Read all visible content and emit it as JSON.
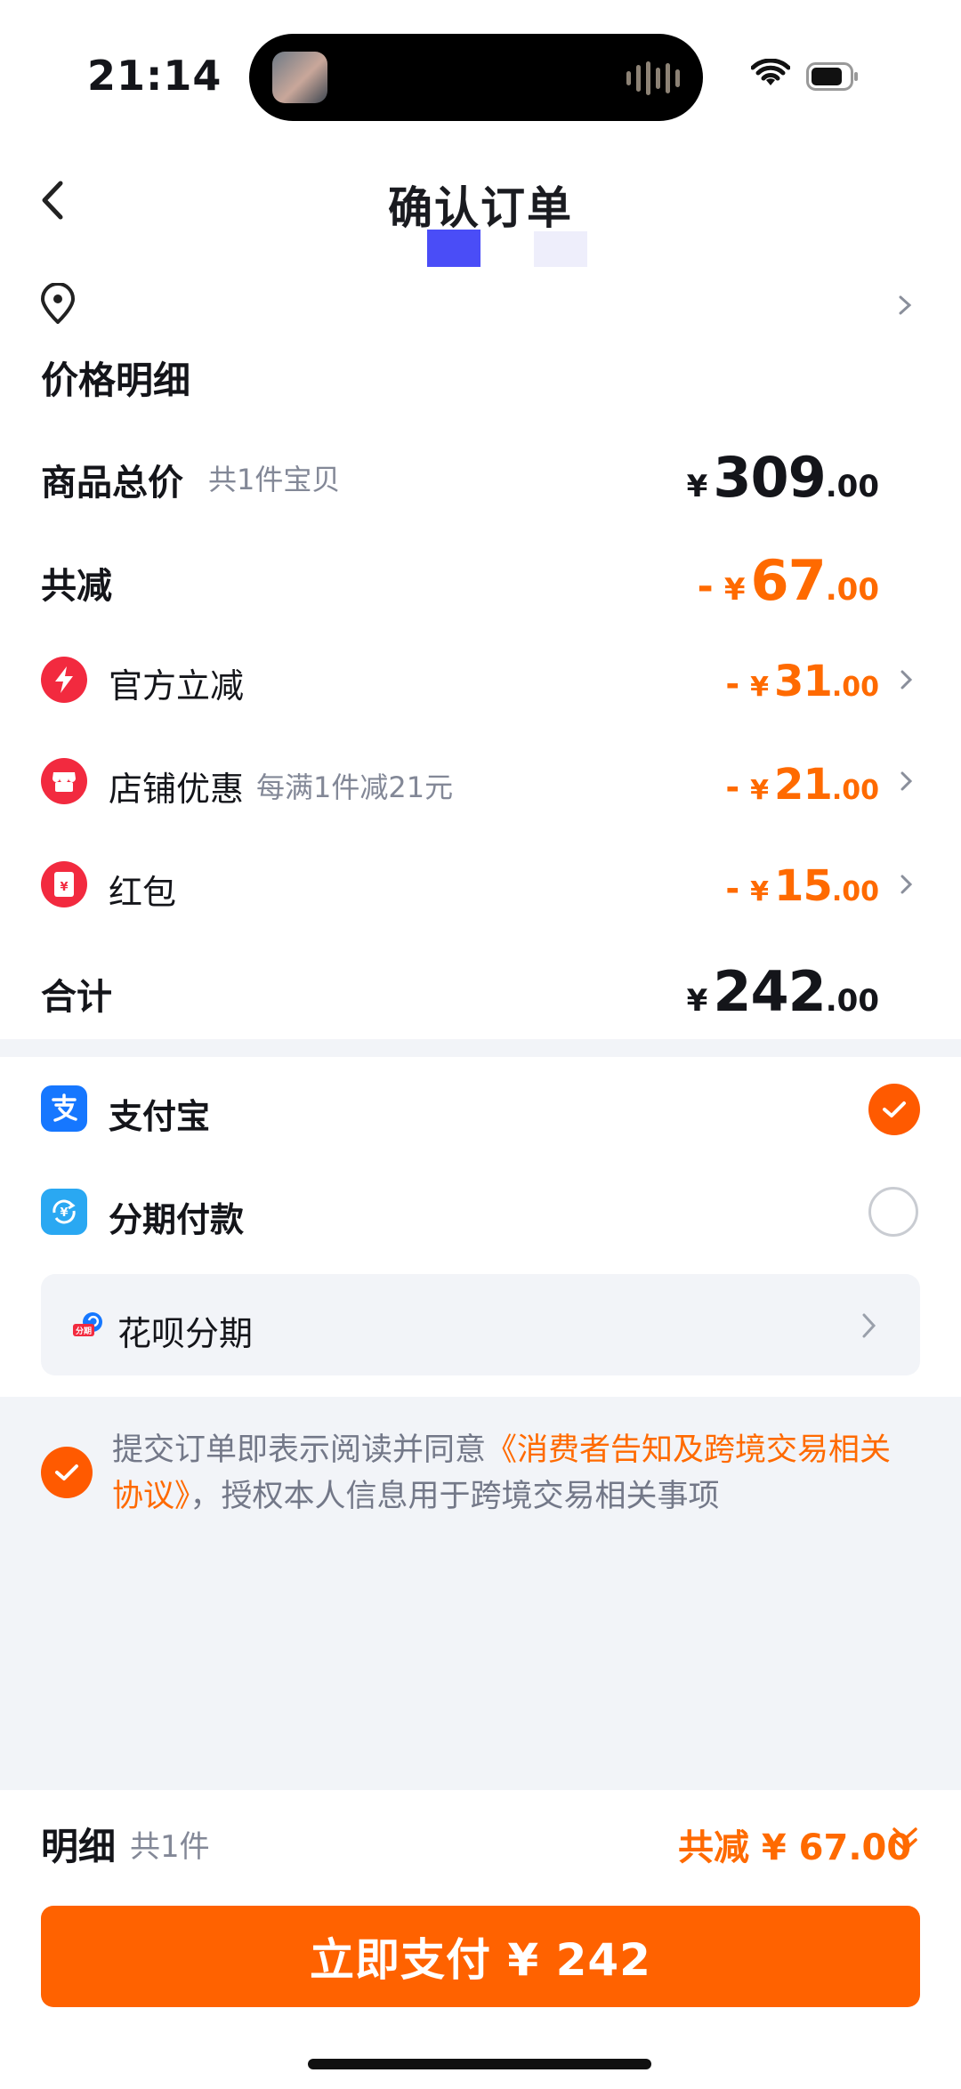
{
  "status_bar": {
    "time": "21:14"
  },
  "header": {
    "title": "确认订单"
  },
  "price_detail": {
    "section_title": "价格明细",
    "total": {
      "label": "商品总价",
      "sub": "共1件宝贝",
      "symbol": "¥",
      "integer": "309",
      "decimal": ".00"
    },
    "discount_total": {
      "label": "共减",
      "minus": "-",
      "symbol": "¥",
      "integer": "67",
      "decimal": ".00"
    },
    "discounts": [
      {
        "label": "官方立减",
        "sub": "",
        "minus": "-",
        "symbol": "¥",
        "integer": "31",
        "decimal": ".00",
        "icon": "lightning-icon"
      },
      {
        "label": "店铺优惠",
        "sub": "每满1件减21元",
        "minus": "-",
        "symbol": "¥",
        "integer": "21",
        "decimal": ".00",
        "icon": "shop-icon"
      },
      {
        "label": "红包",
        "sub": "",
        "minus": "-",
        "symbol": "¥",
        "integer": "15",
        "decimal": ".00",
        "icon": "red-packet-icon"
      }
    ],
    "sum": {
      "label": "合计",
      "symbol": "¥",
      "integer": "242",
      "decimal": ".00"
    }
  },
  "payment": {
    "methods": [
      {
        "label": "支付宝",
        "icon": "alipay-icon",
        "selected": true
      },
      {
        "label": "分期付款",
        "icon": "installment-icon",
        "selected": false
      }
    ],
    "huabei": {
      "label": "花呗分期",
      "badge": "分期"
    }
  },
  "agreement": {
    "prefix": "提交订单即表示阅读并同意",
    "link": "《消费者告知及跨境交易相关协议》",
    "suffix": "，授权本人信息用于跨境交易相关事项"
  },
  "footer": {
    "detail_label": "明细",
    "detail_count": "共1件",
    "detail_discount": "共减 ¥ 67.00",
    "pay_button": "立即支付 ¥ 242"
  },
  "colors": {
    "accent_orange": "#ff6200",
    "discount_text": "#ff6a00",
    "alipay_blue": "#1677ff",
    "badge_red": "#f22a3f",
    "section_bg": "#f2f4f8"
  }
}
